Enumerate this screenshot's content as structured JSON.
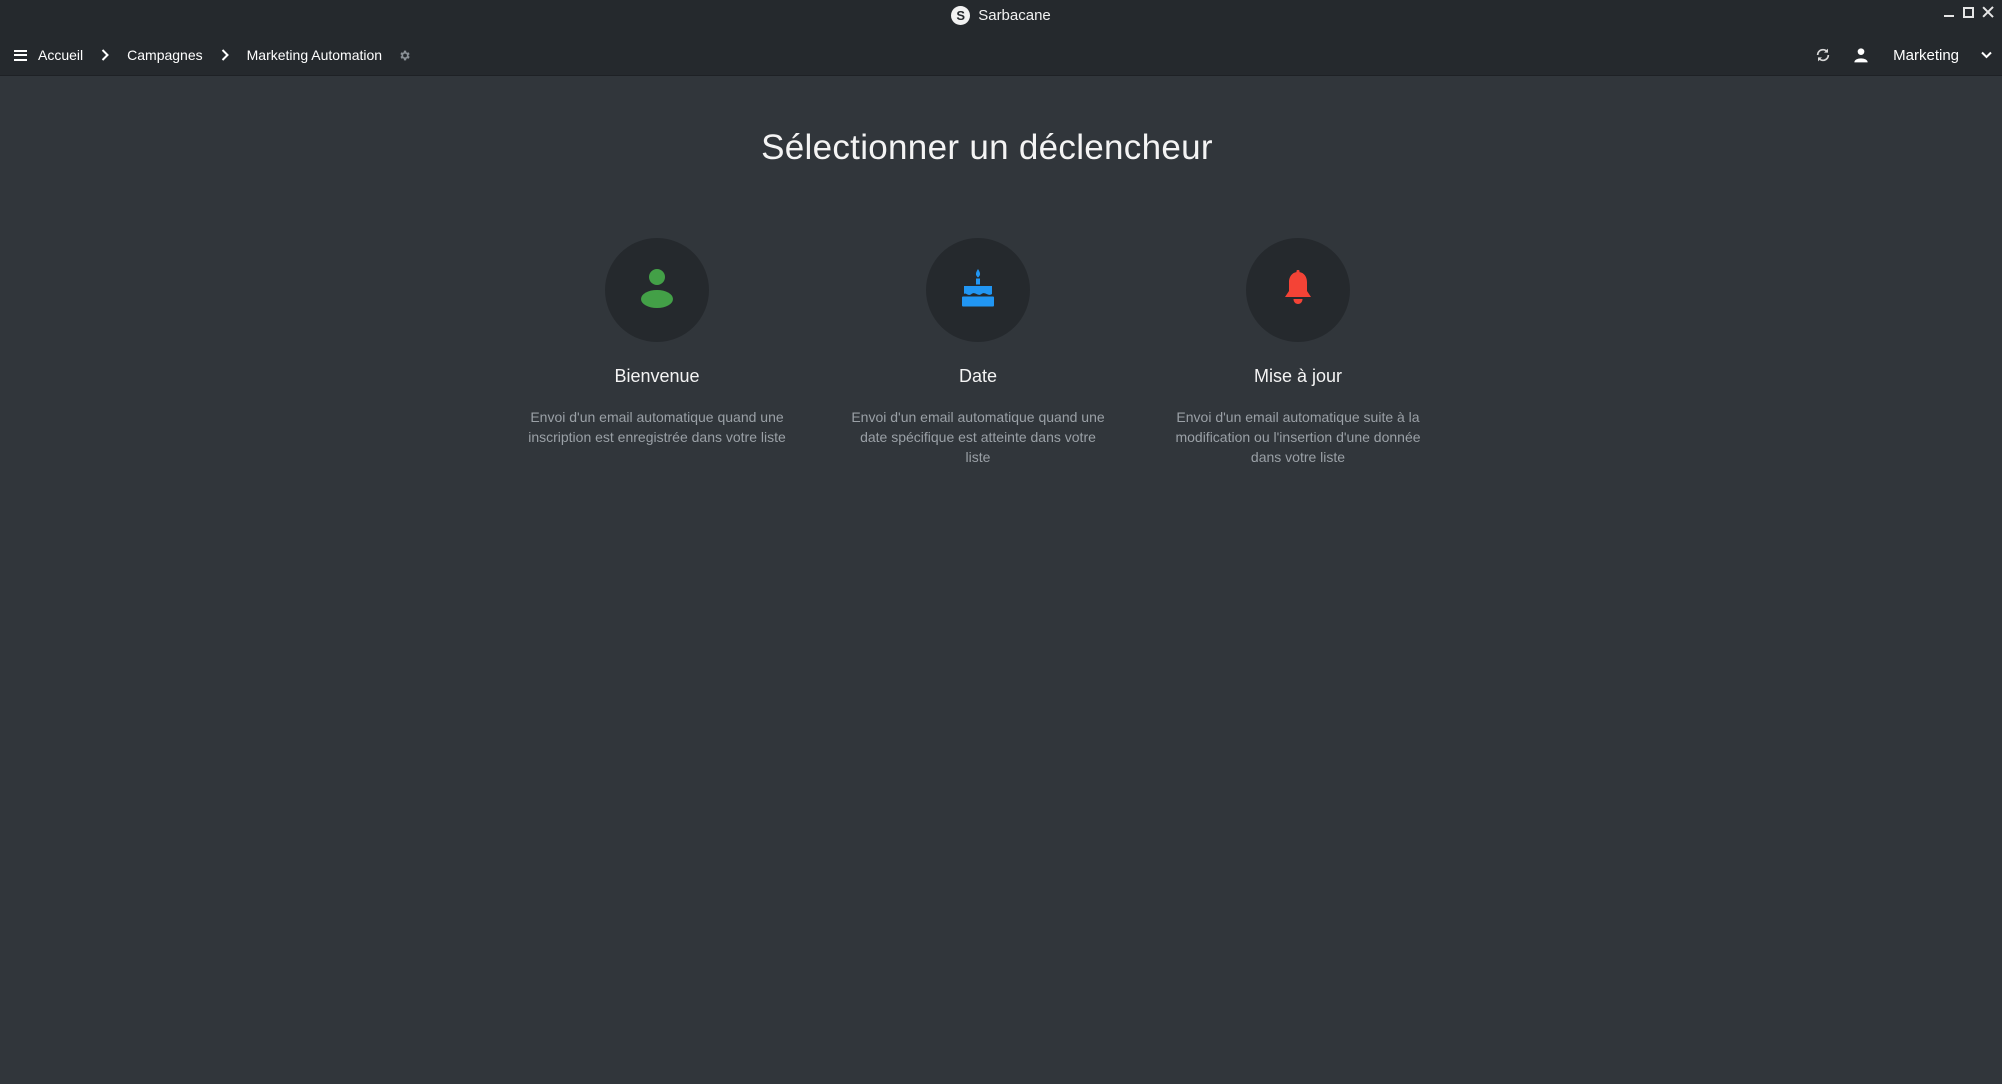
{
  "window": {
    "app_name": "Sarbacane",
    "logo_letter": "S"
  },
  "nav": {
    "breadcrumb": [
      {
        "label": "Accueil"
      },
      {
        "label": "Campagnes"
      },
      {
        "label": "Marketing Automation"
      }
    ],
    "account_label": "Marketing"
  },
  "main": {
    "title": "Sélectionner un déclencheur",
    "triggers": [
      {
        "label": "Bienvenue",
        "description": "Envoi d'un email automatique quand une inscription est enregistrée dans votre liste",
        "icon": "user-icon",
        "color": "#43a047"
      },
      {
        "label": "Date",
        "description": "Envoi d'un email automatique quand une date spécifique est atteinte dans votre liste",
        "icon": "cake-icon",
        "color": "#2196f3"
      },
      {
        "label": "Mise à jour",
        "description": "Envoi d'un email automatique suite à la modification ou l'insertion d'une donnée dans votre liste",
        "icon": "bell-icon",
        "color": "#f44336"
      }
    ]
  },
  "colors": {
    "background": "#31363b",
    "bar": "#25292d",
    "muted_text": "#9aa0a6"
  }
}
